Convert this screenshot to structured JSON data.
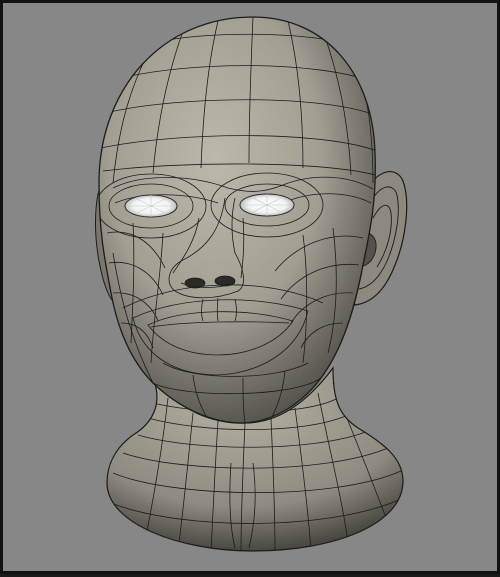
{
  "viewport": {
    "background_color": "#878787",
    "frame_color": "#111111",
    "mesh_fill_color": "#a7a397",
    "mesh_shadow_color": "#5d5a53",
    "wire_color": "#1c1c1c",
    "eye_color": "#ffffff",
    "subject": "head-wireframe-model"
  }
}
